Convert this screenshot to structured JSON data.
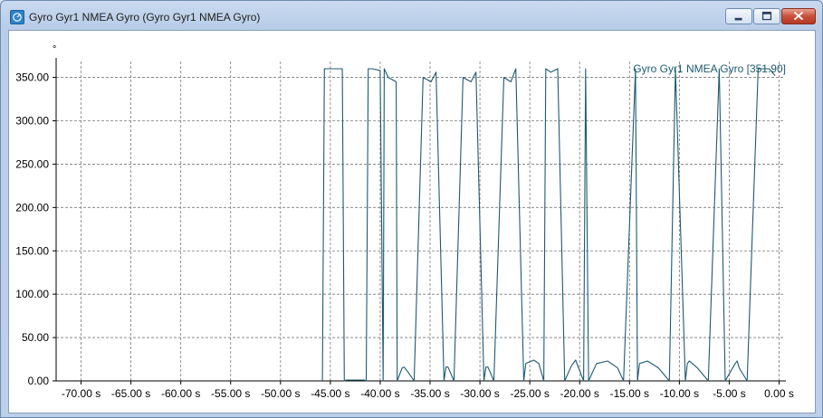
{
  "window": {
    "title": "Gyro Gyr1 NMEA Gyro (Gyro Gyr1 NMEA Gyro)",
    "icon": "app-icon",
    "buttons": [
      "minimize-icon",
      "maximize-icon",
      "close-icon"
    ]
  },
  "chart_data": {
    "type": "line",
    "title": "",
    "xlabel": "",
    "ylabel": "°",
    "x_unit": "s",
    "xlim": [
      -72.5,
      0.5
    ],
    "ylim": [
      0,
      360
    ],
    "x_ticks": [
      -70,
      -65,
      -60,
      -55,
      -50,
      -45,
      -40,
      -35,
      -30,
      -25,
      -20,
      -15,
      -10,
      -5,
      0
    ],
    "x_tick_labels": [
      "-70.00 s",
      "-65.00 s",
      "-60.00 s",
      "-55.00 s",
      "-50.00 s",
      "-45.00 s",
      "-40.00 s",
      "-35.00 s",
      "-30.00 s",
      "-25.00 s",
      "-20.00 s",
      "-15.00 s",
      "-10.00 s",
      "-5.00 s",
      "0.00 s"
    ],
    "y_ticks": [
      0,
      50,
      100,
      150,
      200,
      250,
      300,
      350
    ],
    "y_tick_labels": [
      "0.00",
      "50.00",
      "100.00",
      "150.00",
      "200.00",
      "250.00",
      "300.00",
      "350.00"
    ],
    "grid": true,
    "grid_style": "dashed",
    "line_color": "#1d5a72",
    "legend_placement": "top-right",
    "series": [
      {
        "name": "Gyro Gyr1 NMEA Gyro [351.90]",
        "color": "#1d5a72",
        "x": [
          -45.8,
          -45.6,
          -45.2,
          -44.4,
          -43.8,
          -43.6,
          -43.4,
          -41.6,
          -41.4,
          -41.2,
          -40.8,
          -40.0,
          -39.7,
          -39.6,
          -39.2,
          -38.4,
          -38.3,
          -37.8,
          -37.6,
          -37.2,
          -36.6,
          -35.7,
          -34.9,
          -34.4,
          -33.6,
          -33.4,
          -33.2,
          -32.6,
          -31.7,
          -30.9,
          -30.4,
          -29.6,
          -29.4,
          -29.2,
          -28.6,
          -27.6,
          -26.9,
          -26.4,
          -25.6,
          -25.4,
          -24.6,
          -24.1,
          -23.6,
          -23.4,
          -22.9,
          -22.2,
          -21.5,
          -20.8,
          -20.4,
          -19.6,
          -19.4,
          -19.1,
          -18.3,
          -17.2,
          -16.2,
          -15.6,
          -14.4,
          -14.2,
          -14.0,
          -13.2,
          -12.1,
          -11.0,
          -10.4,
          -9.4,
          -9.2,
          -9.0,
          -8.2,
          -7.1,
          -6.0,
          -5.4,
          -4.4,
          -4.2,
          -4.0,
          -3.2,
          -2.1,
          -1.0,
          -0.4
        ],
        "y": [
          0,
          360,
          360,
          360,
          360,
          0,
          1,
          1,
          0,
          360,
          360,
          358,
          0,
          360,
          350,
          345,
          0,
          15,
          16,
          10,
          0,
          350,
          345,
          356,
          0,
          16,
          16,
          0,
          350,
          345,
          356,
          0,
          16,
          16,
          0,
          350,
          345,
          360,
          0,
          20,
          24,
          20,
          0,
          360,
          356,
          360,
          0,
          18,
          24,
          0,
          360,
          0,
          20,
          23,
          15,
          0,
          360,
          0,
          20,
          23,
          15,
          0,
          360,
          0,
          20,
          23,
          15,
          0,
          360,
          0,
          20,
          23,
          15,
          0,
          360,
          360,
          352
        ]
      }
    ]
  }
}
